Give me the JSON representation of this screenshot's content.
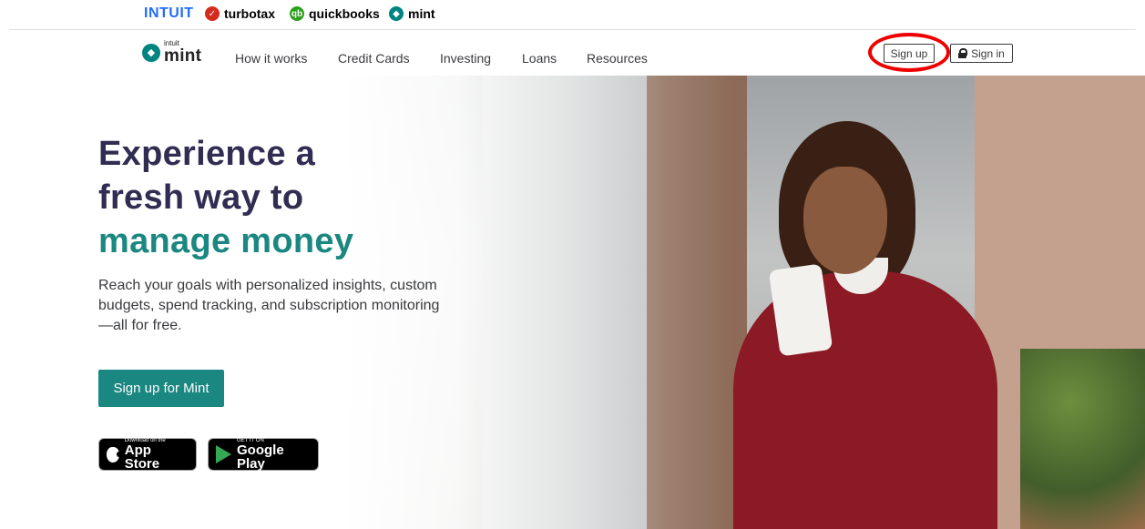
{
  "brandbar": {
    "intuit": "INTUIT",
    "turbotax": "turbotax",
    "quickbooks": "quickbooks",
    "mint": "mint"
  },
  "nav": {
    "logo_small": "intuit",
    "logo_big": "mint",
    "links": [
      "How it works",
      "Credit Cards",
      "Investing",
      "Loans",
      "Resources"
    ],
    "signup": "Sign up",
    "signin": "Sign in"
  },
  "hero": {
    "headline_line1": "Experience a",
    "headline_line2": "fresh way to",
    "headline_line3": "manage money",
    "subtext": "Reach your goals with personalized insights, custom budgets, spend tracking, and subscription monitoring—all for free.",
    "cta": "Sign up for Mint",
    "appstore_small": "Download on the",
    "appstore_big": "App Store",
    "googleplay_small": "GET IT ON",
    "googleplay_big": "Google Play"
  },
  "colors": {
    "accent": "#1a8780",
    "headline": "#302c52",
    "highlight": "#ee0000"
  }
}
